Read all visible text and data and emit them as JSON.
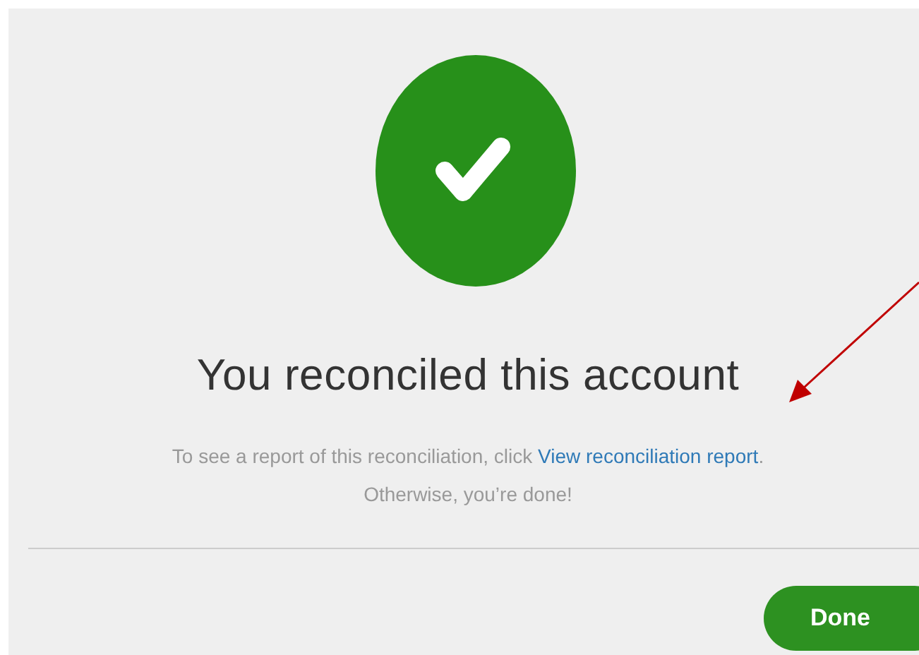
{
  "dialog": {
    "title": "You reconciled this account",
    "message": {
      "before": "To see a report of this reconciliation, click ",
      "link": "View reconciliation report",
      "after": ".",
      "line2": "Otherwise, you’re done!"
    },
    "buttons": [
      "Done"
    ]
  }
}
